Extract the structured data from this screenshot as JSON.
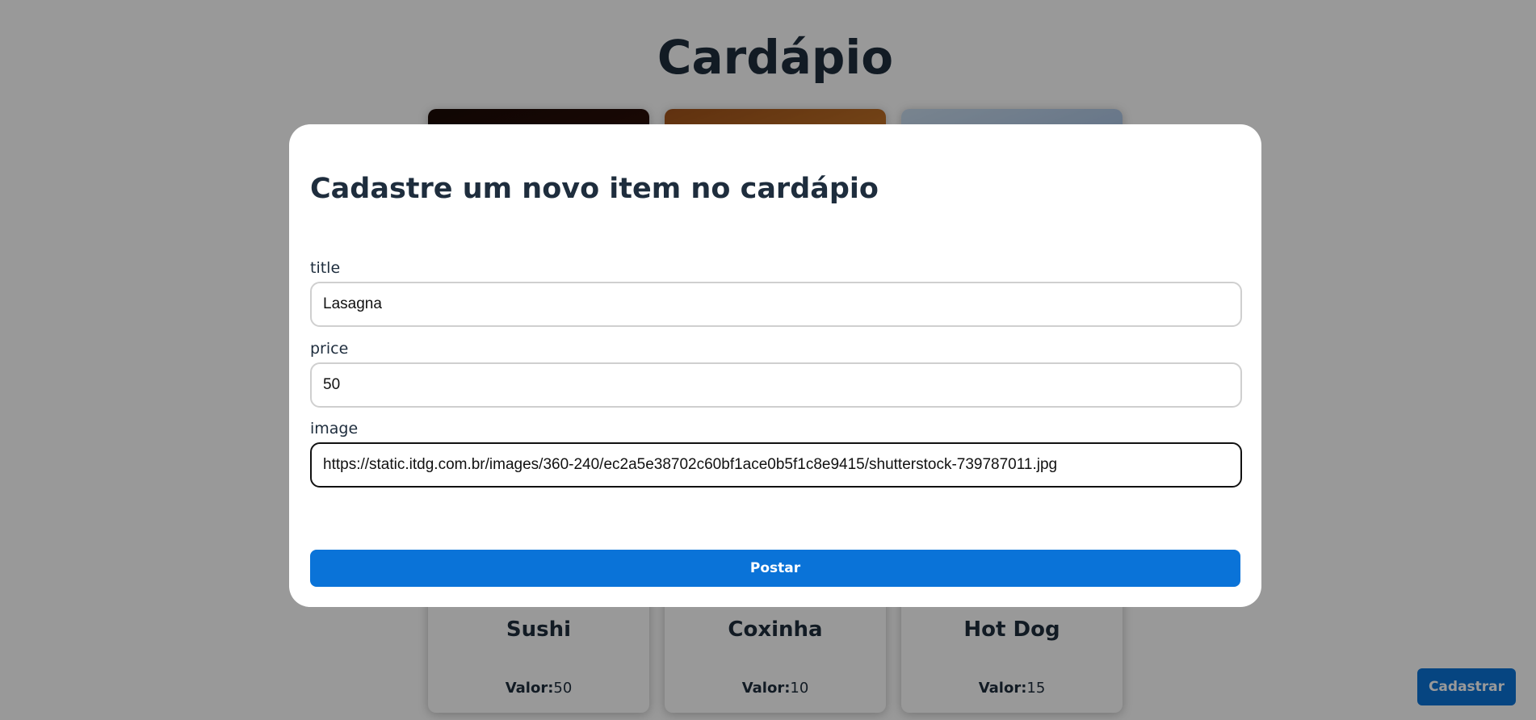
{
  "page": {
    "title": "Cardápio"
  },
  "menu": {
    "items": [
      {
        "name": "Sushi",
        "price_label": "Valor:",
        "price": "50"
      },
      {
        "name": "Coxinha",
        "price_label": "Valor:",
        "price": "10"
      },
      {
        "name": "Hot Dog",
        "price_label": "Valor:",
        "price": "15"
      }
    ]
  },
  "actions": {
    "register_label": "Cadastrar"
  },
  "modal": {
    "title": "Cadastre um novo item no cardápio",
    "fields": [
      {
        "label": "title",
        "value": "Lasagna"
      },
      {
        "label": "price",
        "value": "50"
      },
      {
        "label": "image",
        "value": "https://static.itdg.com.br/images/360-240/ec2a5e38702c60bf1ace0b5f1c8e9415/shutterstock-739787011.jpg"
      }
    ],
    "submit_label": "Postar"
  },
  "colors": {
    "primary": "#0a73d8",
    "text": "#1e2d3d",
    "overlay": "rgba(0,0,0,0.4)"
  }
}
